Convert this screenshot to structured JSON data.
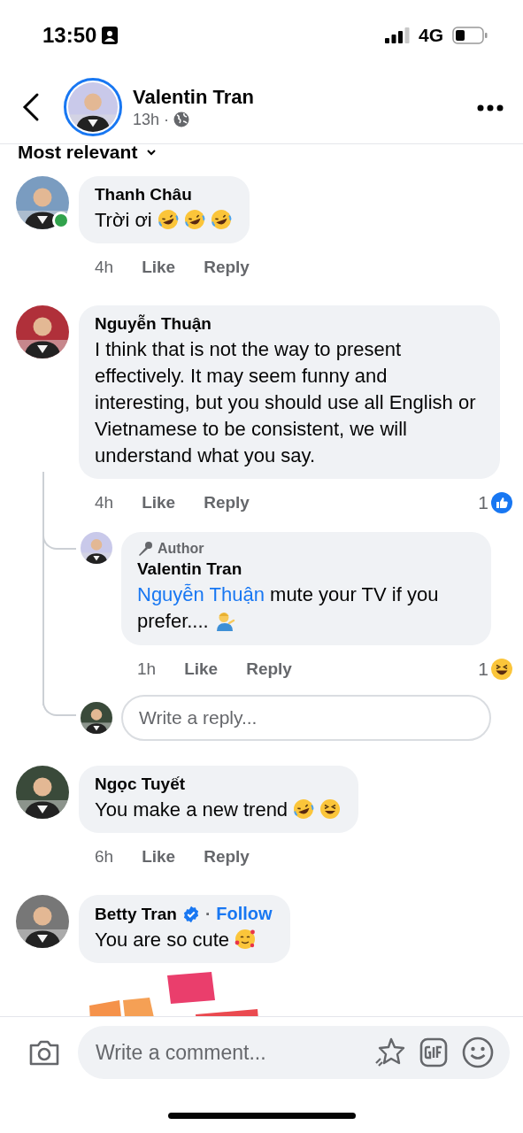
{
  "status_bar": {
    "time": "13:50",
    "network": "4G"
  },
  "header": {
    "name": "Valentin Tran",
    "time": "13h",
    "separator": "·"
  },
  "sort": {
    "label": "Most relevant"
  },
  "comments": [
    {
      "author": "Thanh Châu",
      "online": true,
      "verified": false,
      "text": "Trời ơi",
      "emojis": [
        {
          "kind": "laugh"
        },
        {
          "kind": "laugh"
        },
        {
          "kind": "laugh"
        }
      ],
      "time": "4h",
      "like": "Like",
      "reply": "Reply"
    },
    {
      "author": "Nguyễn Thuận",
      "online": false,
      "verified": false,
      "text": "I think that is not the way to present effectively. It may seem funny and interesting, but you should use all English or Vietnamese to be consistent, we will understand what you say.",
      "time": "4h",
      "like": "Like",
      "reply": "Reply",
      "reaction": {
        "count": "1",
        "kind": "like"
      },
      "replies": [
        {
          "badge": "Author",
          "author": "Valentin Tran",
          "mention": "Nguyễn Thuận",
          "text": "mute your TV if you prefer....",
          "emojis": [
            {
              "kind": "shrug"
            }
          ],
          "time": "1h",
          "like": "Like",
          "reply": "Reply",
          "reaction": {
            "count": "1",
            "kind": "haha"
          }
        }
      ],
      "reply_box": {
        "placeholder": "Write a reply..."
      }
    },
    {
      "author": "Ngọc Tuyết",
      "online": false,
      "verified": false,
      "text": "You make a new trend",
      "emojis": [
        {
          "kind": "laugh"
        },
        {
          "kind": "squint"
        }
      ],
      "time": "6h",
      "like": "Like",
      "reply": "Reply"
    },
    {
      "author": "Betty Tran",
      "online": false,
      "verified": true,
      "separator": "·",
      "follow": "Follow",
      "text": "You are so cute",
      "emojis": [
        {
          "kind": "hearts"
        }
      ],
      "attachment": {
        "kind": "picture"
      }
    }
  ],
  "composer": {
    "placeholder": "Write a comment..."
  }
}
